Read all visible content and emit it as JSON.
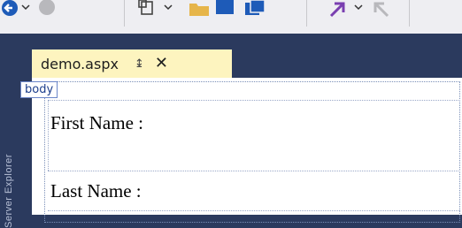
{
  "tab": {
    "title": "demo.aspx",
    "pin_glyph": "↨",
    "close_glyph": "✕"
  },
  "design": {
    "body_tag": "body",
    "fields": [
      {
        "label": "First Name :"
      },
      {
        "label": "Last Name :"
      }
    ]
  },
  "side_panel": {
    "label": "Server Explorer"
  },
  "toolbar_icons": [
    "back-icon",
    "forward-icon",
    "new-item-icon",
    "open-icon",
    "save-icon",
    "save-all-icon",
    "undo-icon",
    "redo-icon"
  ],
  "colors": {
    "ide_frame": "#2b3a5e",
    "active_tab": "#fdf4bf",
    "tag_border": "#6b86c9",
    "tag_text": "#1c3e8c"
  }
}
